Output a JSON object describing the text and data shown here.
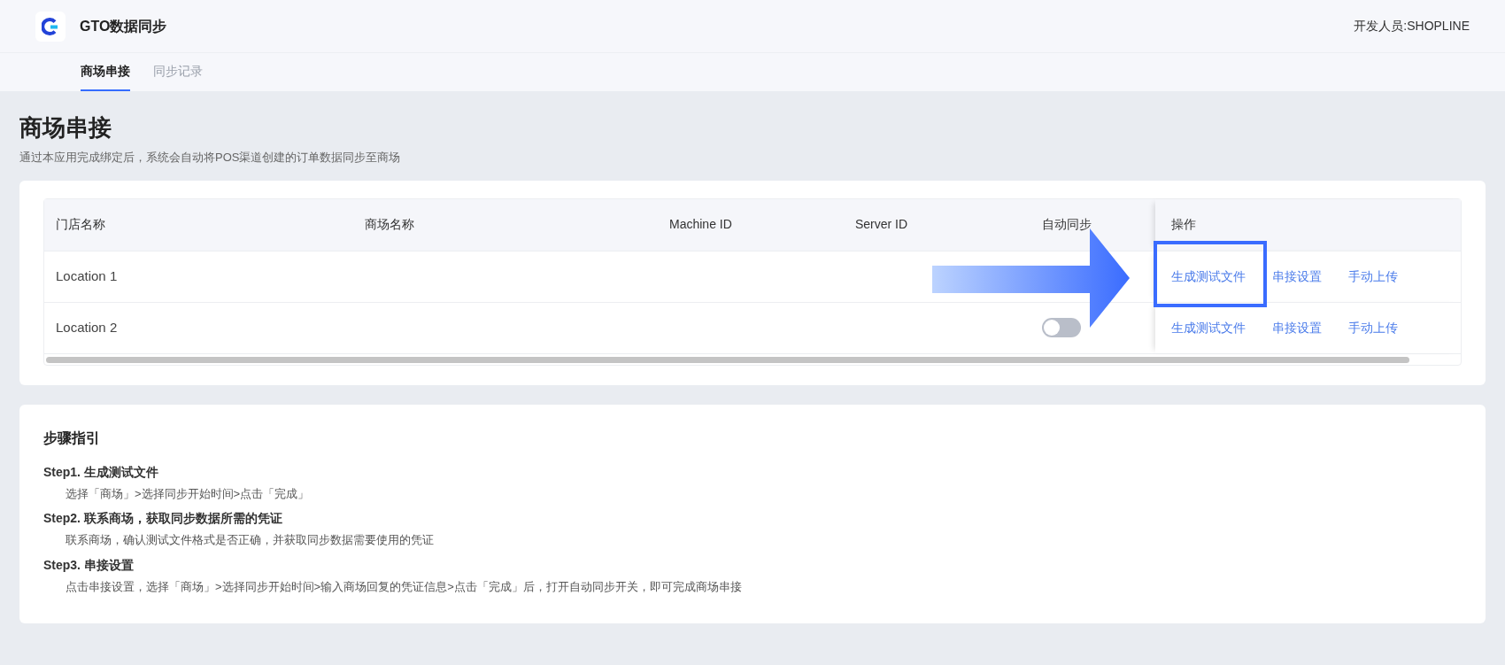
{
  "app": {
    "title": "GTO数据同步",
    "developer": "开发人员:SHOPLINE"
  },
  "tabs": [
    {
      "label": "商场串接",
      "selected": true
    },
    {
      "label": "同步记录",
      "selected": false
    }
  ],
  "page": {
    "title": "商场串接",
    "subtitle": "通过本应用完成绑定后，系统会自动将POS渠道创建的订单数据同步至商场"
  },
  "table": {
    "columns": [
      "门店名称",
      "商场名称",
      "Machine ID",
      "Server ID",
      "自动同步",
      "操作"
    ],
    "rows": [
      {
        "store": "Location 1",
        "actions": [
          {
            "label": "生成测试文件",
            "highlighted": true
          },
          {
            "label": "串接设置",
            "highlighted": false
          },
          {
            "label": "手动上传",
            "highlighted": false
          }
        ]
      },
      {
        "store": "Location 2",
        "auto_sync": {
          "on": false
        },
        "actions": [
          {
            "label": "生成测试文件",
            "highlighted": false
          },
          {
            "label": "串接设置",
            "highlighted": false
          },
          {
            "label": "手动上传",
            "highlighted": false
          }
        ]
      }
    ]
  },
  "guide": {
    "title": "步骤指引",
    "steps": [
      {
        "title": "Step1. 生成测试文件",
        "text": "选择「商场」>选择同步开始时间>点击「完成」"
      },
      {
        "title": "Step2. 联系商场，获取同步数据所需的凭证",
        "text": "联系商场，确认测试文件格式是否正确，并获取同步数据需要使用的凭证"
      },
      {
        "title": "Step3. 串接设置",
        "text": "点击串接设置，选择「商场」>选择同步开始时间>输入商场回复的凭证信息>点击「完成」后，打开自动同步开关，即可完成商场串接"
      }
    ]
  }
}
